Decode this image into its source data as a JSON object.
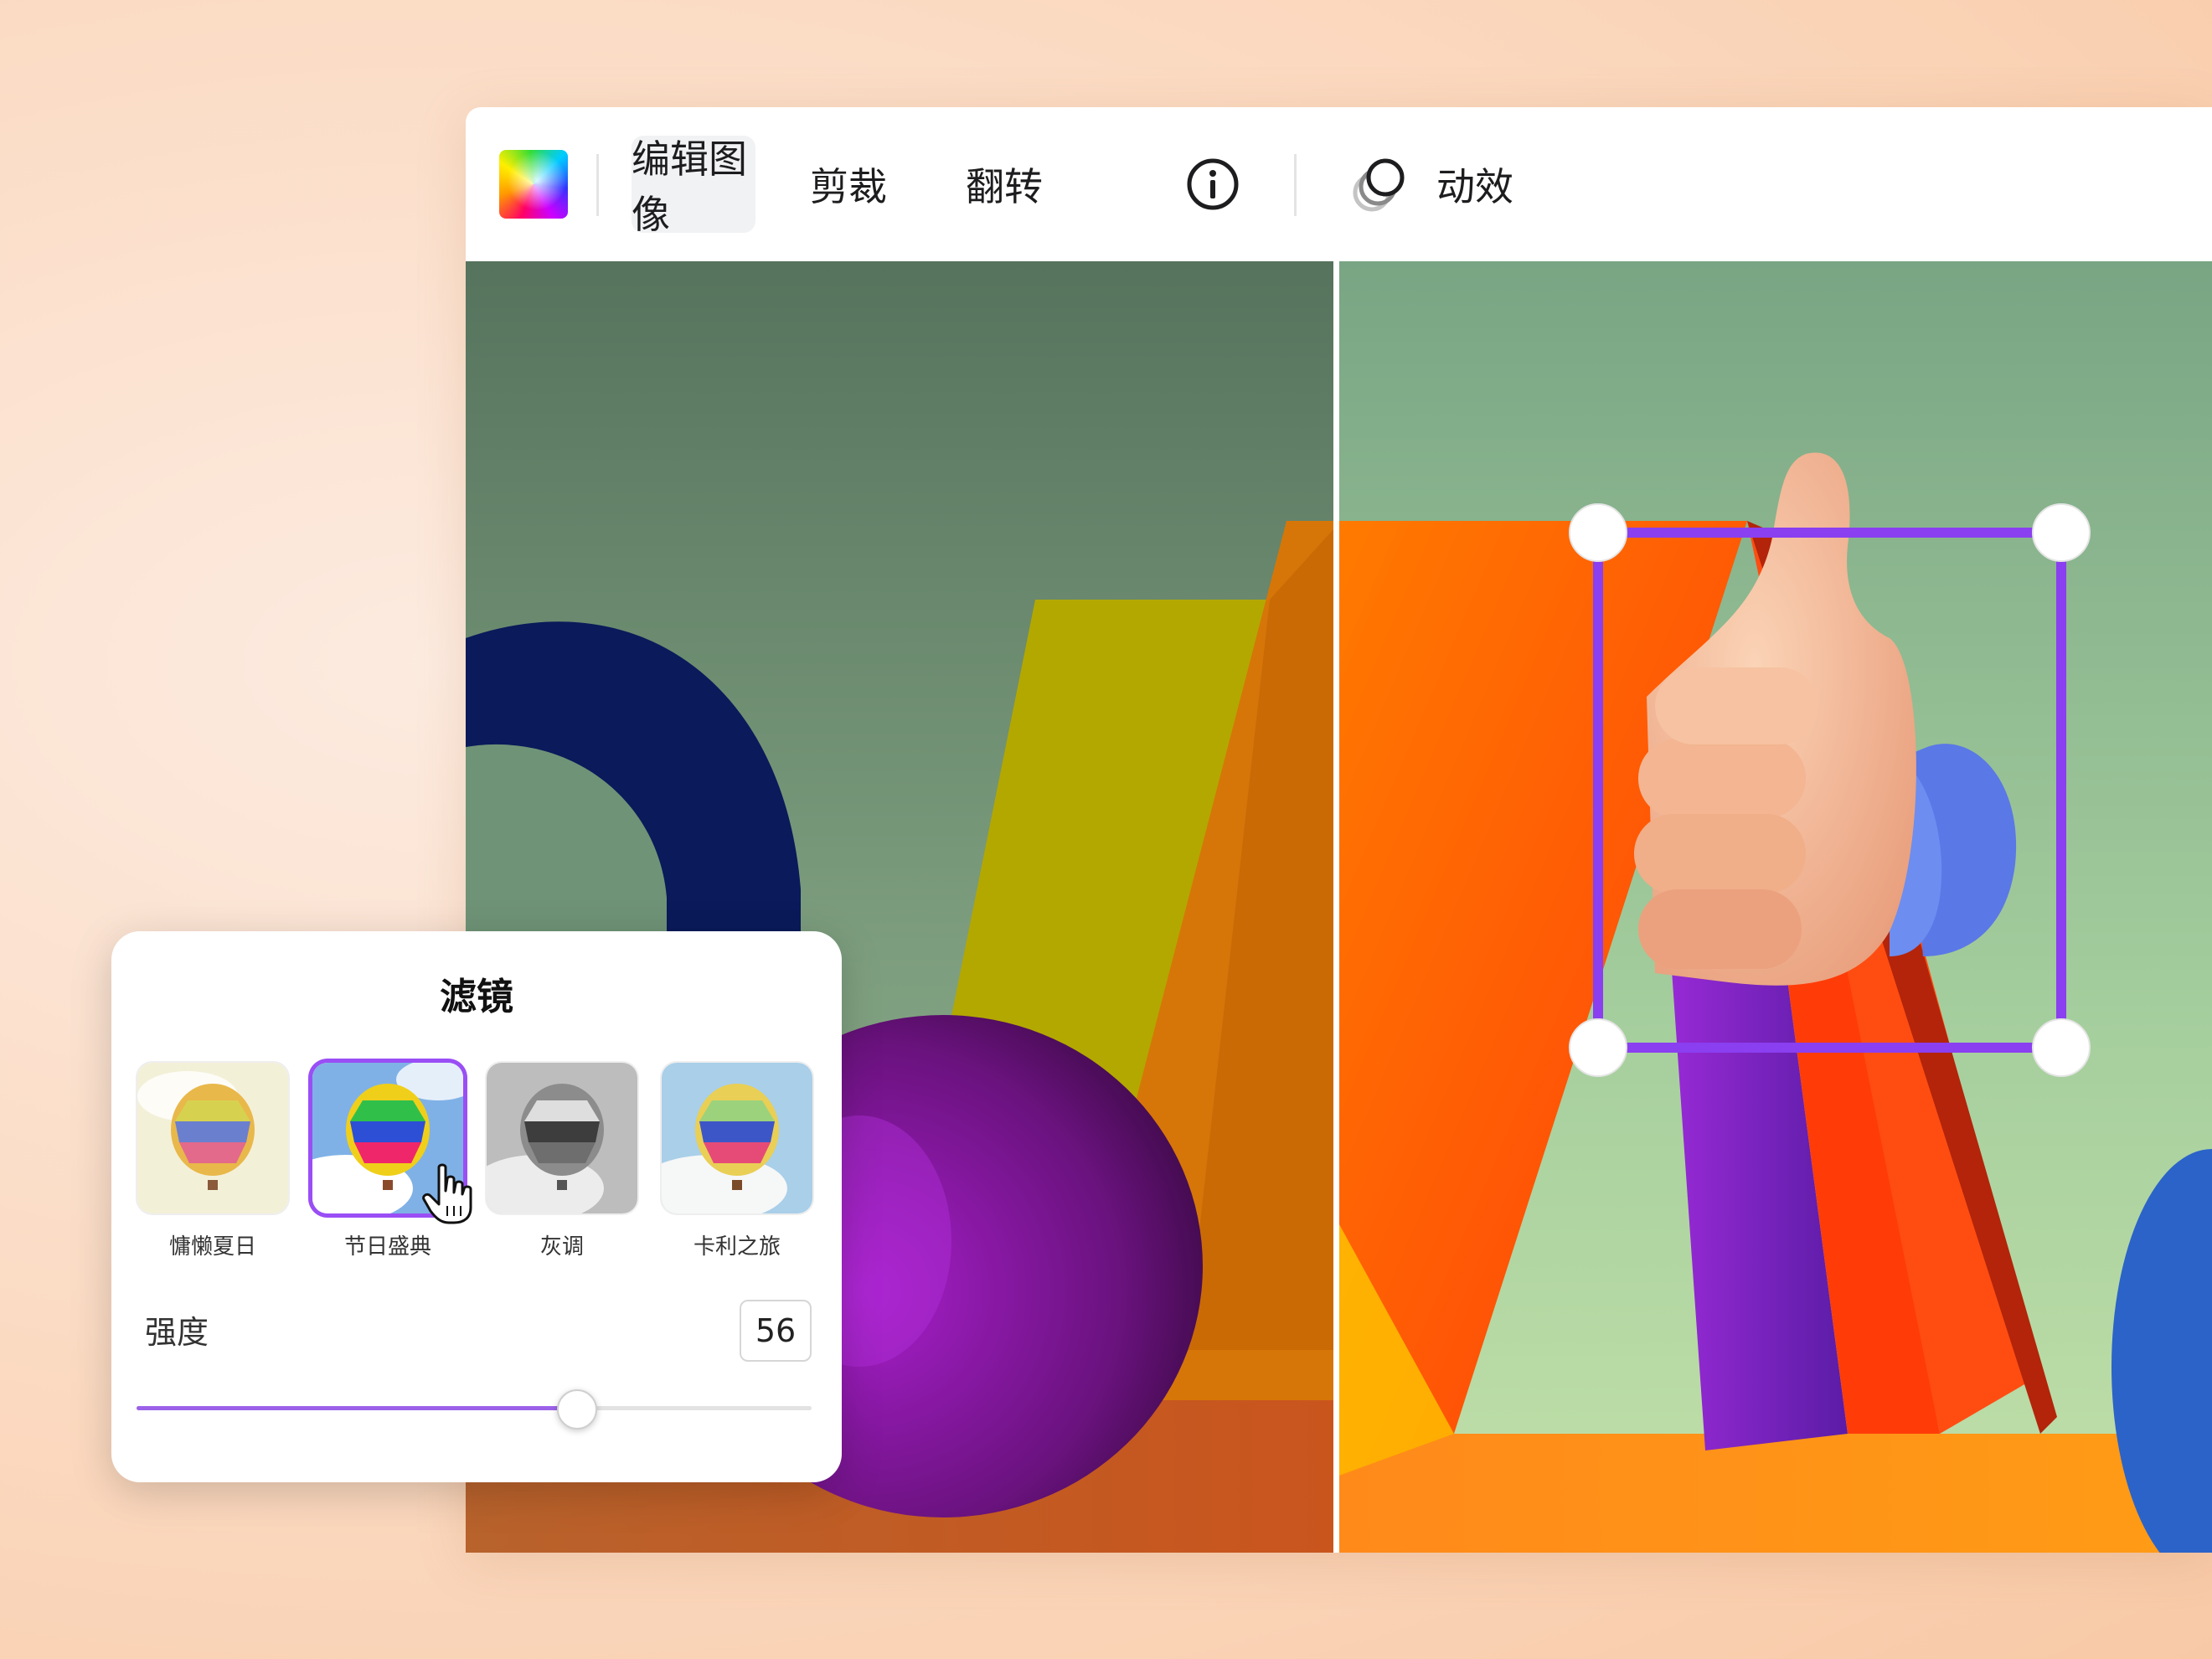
{
  "toolbar": {
    "edit_image": "编辑图像",
    "crop": "剪裁",
    "flip": "翻转",
    "info_icon": "info-icon",
    "motion": "动效",
    "motion_icon": "motion-icon"
  },
  "filter_panel": {
    "title": "滤镜",
    "filters": [
      {
        "label": "慵懒夏日",
        "selected": false
      },
      {
        "label": "节日盛典",
        "selected": true
      },
      {
        "label": "灰调",
        "selected": false
      },
      {
        "label": "卡利之旅",
        "selected": false
      }
    ],
    "strength_label": "强度",
    "strength_value": "56",
    "slider_fraction": 0.65
  },
  "colors": {
    "accent": "#9a4ef5",
    "selection_box": "#8a3ff0"
  }
}
